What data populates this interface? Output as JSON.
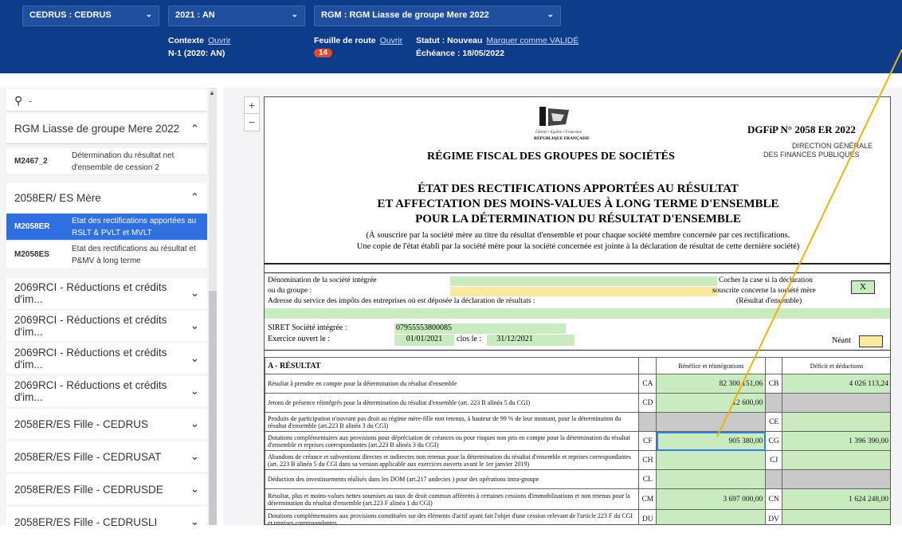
{
  "topbar": {
    "company": "CEDRUS : CEDRUS",
    "year": "2021 : AN",
    "liasse": "RGM : RGM Liasse de groupe Mere 2022",
    "contexte_label": "Contexte",
    "contexte_link": "Ouvrir",
    "n1": "N-1 (2020: AN)",
    "feuille_label": "Feuille de route",
    "feuille_link": "Ouvrir",
    "feuille_badge": "14",
    "statut": "Statut : Nouveau",
    "marquer": "Marquer comme VALIDÉ",
    "echeance": "Échéance : 18/05/2022"
  },
  "sidebar": {
    "search_value": "-",
    "groups": [
      {
        "label": "RGM Liasse de groupe Mere 2022"
      },
      {
        "label": "2058ER/ ES Mère"
      },
      {
        "label": "2069RCI - Réductions et crédits d'im..."
      },
      {
        "label": "2069RCI - Réductions et crédits d'im..."
      },
      {
        "label": "2069RCI - Réductions et crédits d'im..."
      },
      {
        "label": "2069RCI - Réductions et crédits d'im..."
      },
      {
        "label": "2058ER/ES Fille - CEDRUS"
      },
      {
        "label": "2058ER/ES Fille - CEDRUSAT"
      },
      {
        "label": "2058ER/ES Fille - CEDRUSDE"
      },
      {
        "label": "2058ER/ES Fille - CEDRUSLI"
      }
    ],
    "items": [
      {
        "code": "M2467_2",
        "label": "Détermination du résultat net d'ensemble de cession 2"
      },
      {
        "code": "M2058ER",
        "label": "Etat des rectifications apportées au RSLT & PVLT et MVLT"
      },
      {
        "code": "M2058ES",
        "label": "Etat des rectifications au résultat et P&MV à long terme"
      }
    ]
  },
  "zoom": {
    "plus": "+",
    "minus": "−"
  },
  "form": {
    "marianne_text": "Liberté • Égalité • Fraternité",
    "republique": "RÉPUBLIQUE FRANÇAISE",
    "dgfip": "DGFiP N° 2058 ER 2022",
    "direction1": "DIRECTION GÉNÉRALE",
    "direction2": "DES FINANCES PUBLIQUES",
    "regime": "RÉGIME FISCAL DES GROUPES DE SOCIÉTÉS",
    "title1": "ÉTAT DES RECTIFICATIONS APPORTÉES AU RÉSULTAT",
    "title2": "ET AFFECTATION DES MOINS-VALUES À LONG TERME D'ENSEMBLE",
    "title3": "POUR LA DÉTERMINATION DU RÉSULTAT D'ENSEMBLE",
    "note1": "(À souscrire par la société mère au titre du résultat d'ensemble et pour chaque société membre concernée par ces rectifications.",
    "note2": "Une copie de l'état établi par la société mère pour la société concernée est jointe à la déclaration de résultat de cette dernière société)",
    "denom1": "Dénomination de la société intégrée",
    "denom2": "ou du groupe :",
    "cocher1": "Cocher la case si la déclaration",
    "cocher2": "souscrite concerne la société mère",
    "cocher3": "(Résultat d'ensemble)",
    "check_value": "X",
    "adresse": "Adresse du service des impôts des entreprises où est déposée la déclaration de résultats :",
    "siret_label": "SIRET Société intégrée :",
    "siret_value": "07955553800085",
    "exercice_label": "Exercice ouvert le :",
    "exercice_start": "01/01/2021",
    "clos_label": "clos le :",
    "exercice_end": "31/12/2021",
    "neant": "Néant",
    "section_a": "A - RÉSULTAT",
    "col1": "Bénéfice et réintégrations",
    "col2": "Déficit et déductions",
    "rows": [
      {
        "label": "Résultat à prendre en compte pour la détermination du résultat d'ensemble",
        "c1": "CA",
        "v1": "82 300 151,06",
        "c2": "CB",
        "v2": "4 026 113,24"
      },
      {
        "label": "Jetons de présence réintégrés pour la détermination du résultat d'ensemble (art. 223 B alinéa 5 du CGI)",
        "c1": "CD",
        "v1": "12 600,00",
        "c2": "",
        "v2": ""
      },
      {
        "label": "Produits de participation n'ouvrant pas droit au régime mère-fille non retenus, à hauteur de 99 % de leur montant, pour la détermination du résultat d'ensemble (art.223 B alinéa 3 du CGI)",
        "c1": "",
        "v1": "",
        "c2": "CE",
        "v2": ""
      },
      {
        "label": "Dotations complémentaires aux provisions pour dépréciation de créances ou pour risques non pris en compte pour la détermination du résultat d'ensemble et reprises correspondantes (art.223 B alinéa 3 du CGI)",
        "c1": "CF",
        "v1": "905 380,00",
        "c2": "CG",
        "v2": "1 396 390,00"
      },
      {
        "label": "Abandons de créance et subventions directes et indirectes non retenus pour la détermination du résultat d'ensemble et reprises correspondantes (art. 223 B alinéa 5 du CGI dans sa version applicable aux exercices ouverts avant le 1er janvier 2019)",
        "c1": "CH",
        "v1": "",
        "c2": "CJ",
        "v2": ""
      },
      {
        "label": "Déduction des investissements réalisés dans les DOM (art.217 undecies ) pour des opérations intra-groupe",
        "c1": "CL",
        "v1": "",
        "c2": "",
        "v2": ""
      },
      {
        "label": "Résultat, plus et moins-values nettes soumises au taux de droit commun afférents à certaines cessions d'immobilisations et non retenus pour la détermination du résultat d'ensemble (art.223 F alinéa 1 du CGI)",
        "c1": "CM",
        "v1": "3 697 000,00",
        "c2": "CN",
        "v2": "1 624 248,00"
      },
      {
        "label": "Dotations complémentaires aux provisions constituées sur des éléments d'actif ayant fait l'objet d'une cession relevant de l'article 223 F du CGI et reprises correspondantes",
        "c1": "DU",
        "v1": "",
        "c2": "DV",
        "v2": ""
      }
    ]
  }
}
